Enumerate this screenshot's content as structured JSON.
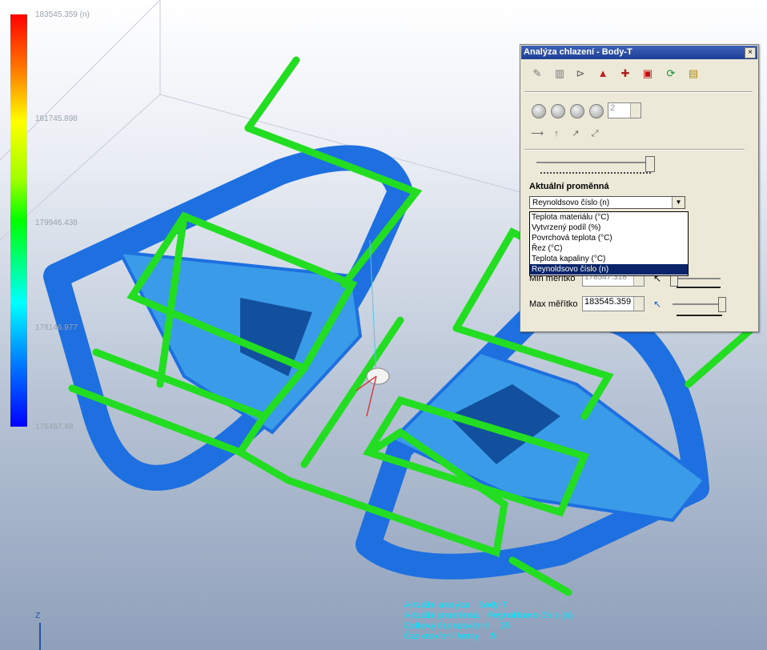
{
  "legend": {
    "values": [
      "183545.359 (n)",
      "181745.898",
      "179946.438",
      "178146.977",
      "176467.48"
    ]
  },
  "dialog": {
    "title": "Analýza chlazení - Body-T",
    "close_label": "×",
    "frame_value": "2",
    "section_title": "Aktuální proměnná",
    "selected_variable": "Reynoldsovo číslo (n)",
    "variable_options": [
      "Teplota materiálu (°C)",
      "Vytvrzený podíl (%)",
      "Povrchová teplota (°C)",
      "Řez (°C)",
      "Teplota kapaliny (°C)",
      "Reynoldsovo číslo (n)"
    ],
    "min_label": "Min měřítko",
    "min_value": "178547.318",
    "max_label": "Max měřítko",
    "max_value": "183545.359"
  },
  "info": {
    "analysis_label": "Aktuální analýza:",
    "analysis_value": "Body-T",
    "variable_label": "Aktuální proměnná:",
    "variable_value": "Reynoldsovo číslo (n)",
    "close_time_label": "Celkový čas uzavření:",
    "close_time_value": "35",
    "open_time_label": "Čas otevření formy:",
    "open_time_value": "5"
  },
  "axes": {
    "z": "Z"
  },
  "colors": {
    "channel": "#22dd22",
    "part": "#1e78e6",
    "accent": "#00e5ff"
  }
}
